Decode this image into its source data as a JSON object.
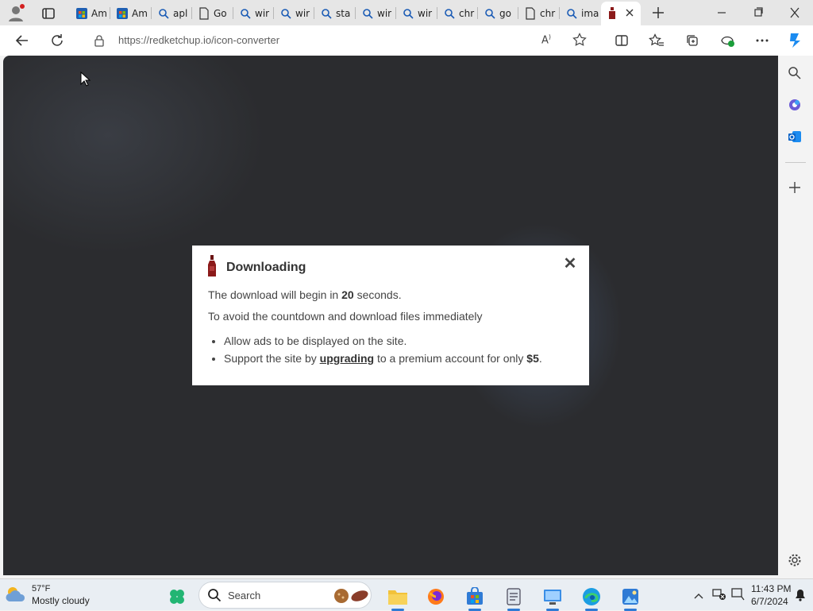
{
  "browser": {
    "tabs": [
      {
        "label": "Am",
        "icon": "store-icon"
      },
      {
        "label": "Am",
        "icon": "store-icon"
      },
      {
        "label": "apl",
        "icon": "search-icon"
      },
      {
        "label": "Go",
        "icon": "page-icon"
      },
      {
        "label": "wir",
        "icon": "search-icon"
      },
      {
        "label": "wir",
        "icon": "search-icon"
      },
      {
        "label": "sta",
        "icon": "search-icon"
      },
      {
        "label": "wir",
        "icon": "search-icon"
      },
      {
        "label": "wir",
        "icon": "search-icon"
      },
      {
        "label": "chr",
        "icon": "search-icon"
      },
      {
        "label": "go",
        "icon": "search-icon"
      },
      {
        "label": "chr",
        "icon": "page-icon"
      },
      {
        "label": "ima",
        "icon": "search-icon"
      }
    ],
    "active_tab_icon": "ketchup-bottle-icon",
    "address": "https://redketchup.io/icon-converter"
  },
  "modal": {
    "title": "Downloading",
    "line1_before": "The download will begin in ",
    "countdown": "20",
    "line1_after": " seconds.",
    "line2": "To avoid the countdown and download files immediately",
    "bullet1": "Allow ads to be displayed on the site.",
    "bullet2_before": "Support the site by ",
    "bullet2_link": "upgrading",
    "bullet2_middle": " to a premium account for only ",
    "bullet2_price": "$5",
    "bullet2_end": "."
  },
  "taskbar": {
    "weather_temp": "57°F",
    "weather_desc": "Mostly cloudy",
    "search_placeholder": "Search",
    "time": "11:43 PM",
    "date": "6/7/2024"
  },
  "colors": {
    "accent": "#2f7bd5",
    "ketchup": "#8b1a1a",
    "viewport_bg": "#2b2c2f"
  }
}
